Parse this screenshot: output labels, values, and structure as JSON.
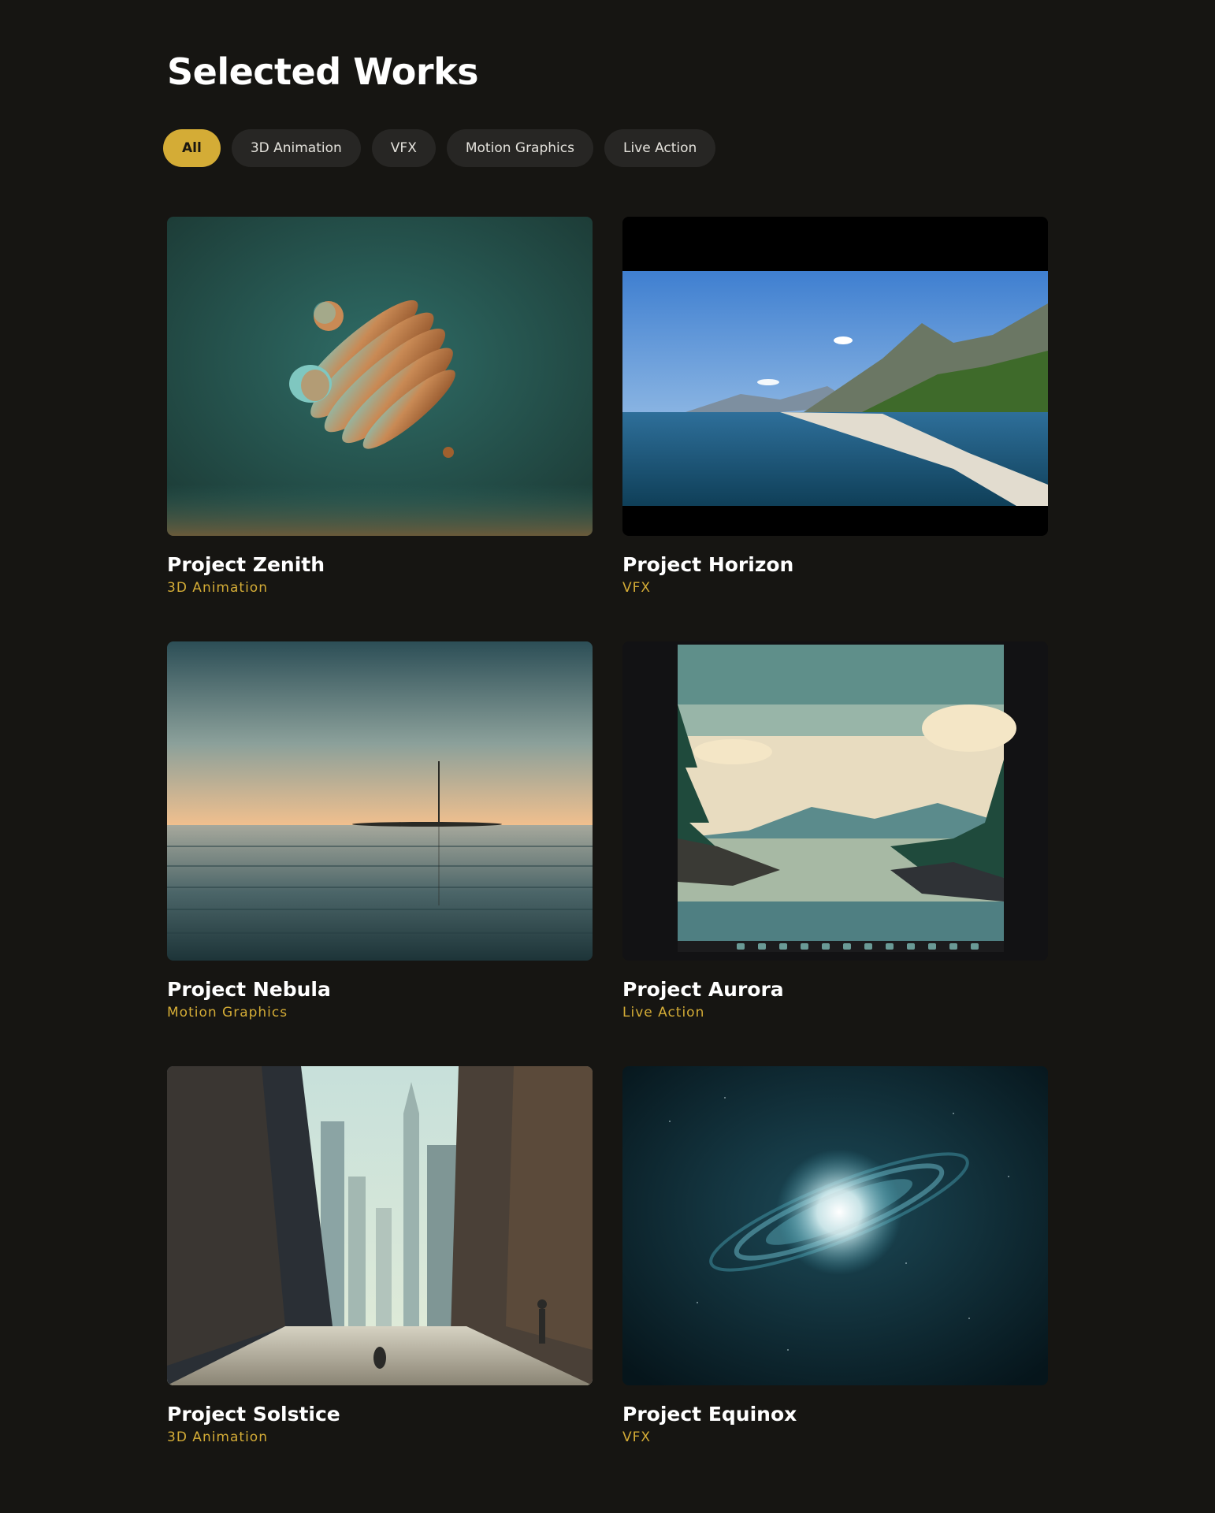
{
  "page": {
    "title": "Selected Works"
  },
  "filters": [
    {
      "label": "All",
      "active": true
    },
    {
      "label": "3D Animation",
      "active": false
    },
    {
      "label": "VFX",
      "active": false
    },
    {
      "label": "Motion Graphics",
      "active": false
    },
    {
      "label": "Live Action",
      "active": false
    }
  ],
  "projects": [
    {
      "title": "Project Zenith",
      "category": "3D Animation",
      "thumbnail": "abstract-3d-sculpture"
    },
    {
      "title": "Project Horizon",
      "category": "VFX",
      "thumbnail": "mountain-coastline"
    },
    {
      "title": "Project Nebula",
      "category": "Motion Graphics",
      "thumbnail": "calm-sea-horizon"
    },
    {
      "title": "Project Aurora",
      "category": "Live Action",
      "thumbnail": "illustrated-lake-forest"
    },
    {
      "title": "Project Solstice",
      "category": "3D Animation",
      "thumbnail": "city-street-skyscrapers"
    },
    {
      "title": "Project Equinox",
      "category": "VFX",
      "thumbnail": "glowing-galaxy"
    }
  ],
  "colors": {
    "background": "#161512",
    "accent": "#d4ac36",
    "pill": "#272624"
  }
}
